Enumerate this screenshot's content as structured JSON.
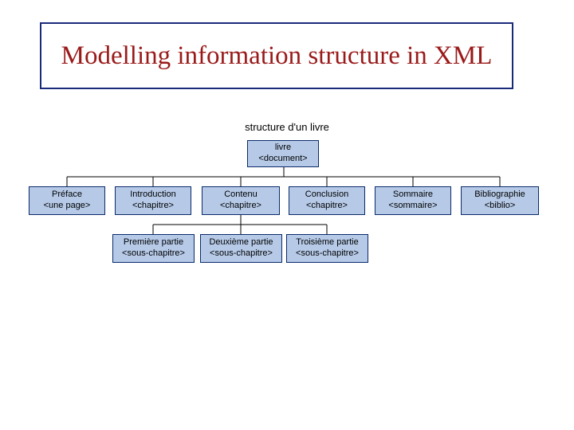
{
  "title": "Modelling information structure in XML",
  "caption": "structure d'un livre",
  "root": {
    "label1": "livre",
    "label2": "<document>"
  },
  "level1": [
    {
      "label1": "Préface",
      "label2": "<une page>"
    },
    {
      "label1": "Introduction",
      "label2": "<chapitre>"
    },
    {
      "label1": "Contenu",
      "label2": "<chapitre>"
    },
    {
      "label1": "Conclusion",
      "label2": "<chapitre>"
    },
    {
      "label1": "Sommaire",
      "label2": "<sommaire>"
    },
    {
      "label1": "Bibliographie",
      "label2": "<biblio>"
    }
  ],
  "level2": [
    {
      "label1": "Première partie",
      "label2": "<sous-chapitre>"
    },
    {
      "label1": "Deuxième partie",
      "label2": "<sous-chapitre>"
    },
    {
      "label1": "Troisième partie",
      "label2": "<sous-chapitre>"
    }
  ]
}
